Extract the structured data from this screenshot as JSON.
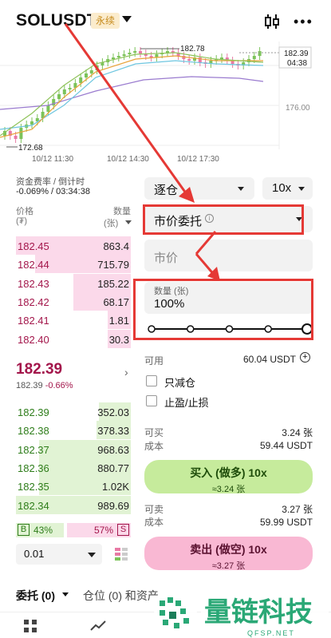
{
  "header": {
    "symbol": "SOLUSDT",
    "contract_type": "永续",
    "icons": [
      "chevron-down-icon",
      "candlestick-icon",
      "more-icon"
    ]
  },
  "chart": {
    "price_high_marker": "182.78",
    "price_low_marker": "172.68",
    "current_price": "182.39",
    "countdown": "04:38",
    "axis_price": "176.00",
    "times": [
      "10/12 11:30",
      "10/12 14:30",
      "10/12 17:30"
    ]
  },
  "funding": {
    "label": "资金费率 / 倒计时",
    "value": "-0.069% / 03:34:38"
  },
  "orderbook": {
    "price_header": "价格",
    "price_unit": "(₮)",
    "qty_header": "数量",
    "qty_unit": "(张)",
    "asks": [
      {
        "price": "182.45",
        "qty": "863.4",
        "depth": 1.0
      },
      {
        "price": "182.44",
        "qty": "715.79",
        "depth": 0.83
      },
      {
        "price": "182.43",
        "qty": "185.22",
        "depth": 0.5
      },
      {
        "price": "182.42",
        "qty": "68.17",
        "depth": 0.5
      },
      {
        "price": "182.41",
        "qty": "1.81",
        "depth": 0.2
      },
      {
        "price": "182.40",
        "qty": "30.3",
        "depth": 0.2
      }
    ],
    "last_price": "182.39",
    "last_sub_price": "182.39",
    "last_change": "-0.66%",
    "bids": [
      {
        "price": "182.39",
        "qty": "352.03",
        "depth": 0.28
      },
      {
        "price": "182.38",
        "qty": "378.33",
        "depth": 0.3
      },
      {
        "price": "182.37",
        "qty": "968.63",
        "depth": 0.8
      },
      {
        "price": "182.36",
        "qty": "880.77",
        "depth": 0.8
      },
      {
        "price": "182.35",
        "qty": "1.02K",
        "depth": 0.8
      },
      {
        "price": "182.34",
        "qty": "989.69",
        "depth": 1.0
      }
    ],
    "buy_tag": "B",
    "buy_ratio": "43%",
    "sell_ratio": "57%",
    "sell_tag": "S",
    "buy_ratio_value": 0.43,
    "precision": "0.01"
  },
  "order_form": {
    "margin_mode": "逐仓",
    "leverage": "10x",
    "order_type": "市价委托",
    "price_placeholder": "市价",
    "qty_label": "数量 (张)",
    "qty_value": "100%",
    "slider_value": 1.0,
    "available_label": "可用",
    "available_value": "60.04 USDT",
    "reduce_only": "只减仓",
    "tp_sl": "止盈/止损",
    "can_buy_label": "可买",
    "can_buy_value": "3.24 张",
    "cost_label": "成本",
    "buy_cost_value": "59.44 USDT",
    "buy_button": "买入 (做多) 10x",
    "buy_button_sub": "≈3.24 张",
    "can_sell_label": "可卖",
    "can_sell_value": "3.27 张",
    "sell_cost_value": "59.99 USDT",
    "sell_button": "卖出 (做空) 10x",
    "sell_button_sub": "≈3.27 张"
  },
  "tabs": {
    "orders": "委托 (0)",
    "positions": "仓位 (0) 和资产"
  },
  "watermark": {
    "brand": "量链科技",
    "site": "QFSP.NET"
  },
  "colors": {
    "ask": "#a3164b",
    "bid": "#2e7d1a",
    "buy_button": "#c6eb9c",
    "sell_button": "#f9b8d3",
    "annotation": "#e53935"
  }
}
